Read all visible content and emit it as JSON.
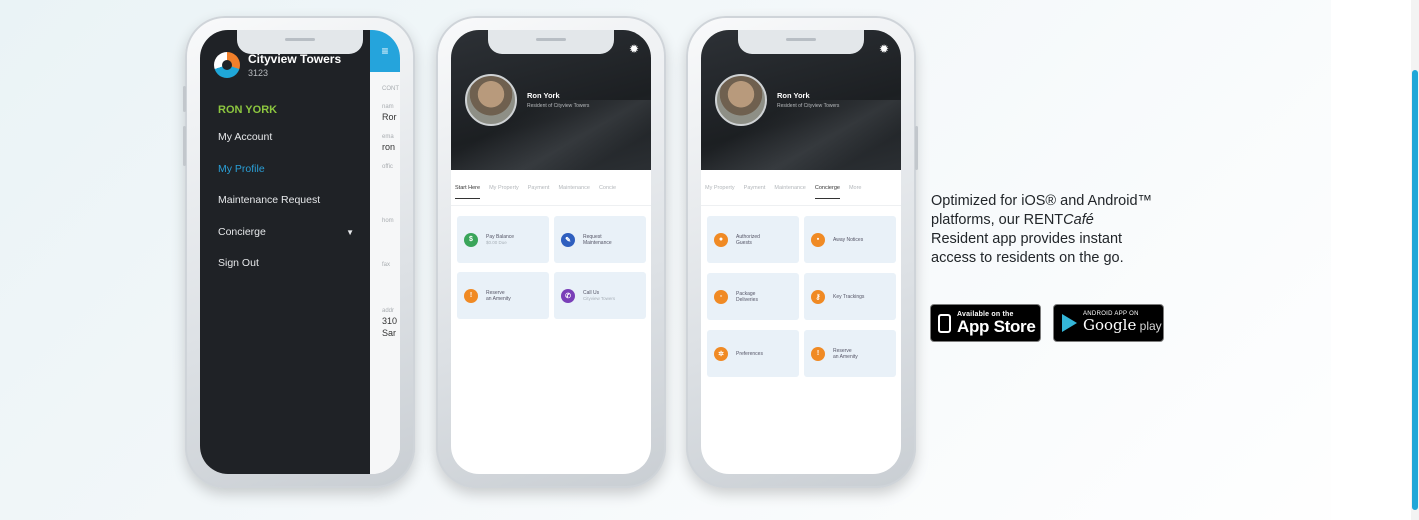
{
  "phone1": {
    "app_name": "Cityview Towers",
    "unit": "3123",
    "user_name": "RON YORK",
    "menu_items": [
      {
        "label": "My Account"
      },
      {
        "label": "My Profile"
      },
      {
        "label": "Maintenance Request"
      },
      {
        "label": "Concierge"
      },
      {
        "label": "Sign Out"
      }
    ],
    "profile_strip": {
      "section": "CONT",
      "fields": [
        {
          "label": "nam",
          "value": "Ror"
        },
        {
          "label": "ema",
          "value": "ron"
        },
        {
          "label": "offic",
          "value": ""
        },
        {
          "label": "hom",
          "value": ""
        },
        {
          "label": "fax",
          "value": ""
        },
        {
          "label": "addr",
          "value": "310"
        },
        {
          "label": "",
          "value": "Sar"
        }
      ]
    }
  },
  "phone2": {
    "name": "Ron York",
    "subtitle": "Resident of Cityview Towers",
    "tabs": [
      "Start Here",
      "My Property",
      "Payment",
      "Maintenance",
      "Concie"
    ],
    "tiles": [
      {
        "line1": "Pay Balance",
        "line2": "$0.00 Due",
        "color": "#3aa55a",
        "icon": "$"
      },
      {
        "line1": "Request",
        "line2": "Maintenance",
        "color": "#2f5fbf",
        "icon": "✎"
      },
      {
        "line1": "Reserve",
        "line2": "an Amenity",
        "color": "#f08a24",
        "icon": "!"
      },
      {
        "line1": "Call Us",
        "line2": "Cityview Towers",
        "color": "#7a3fb8",
        "icon": "✆"
      }
    ]
  },
  "phone3": {
    "name": "Ron York",
    "subtitle": "Resident of Cityview Towers",
    "tabs": [
      "My Property",
      "Payment",
      "Maintenance",
      "Concierge",
      "More"
    ],
    "tiles": [
      {
        "line1": "Authorized",
        "line2": "Guests"
      },
      {
        "line1": "Away Notices",
        "line2": ""
      },
      {
        "line1": "Package",
        "line2": "Deliveries"
      },
      {
        "line1": "Key Trackings",
        "line2": ""
      },
      {
        "line1": "Preferences",
        "line2": ""
      },
      {
        "line1": "Reserve",
        "line2": "an Amenity"
      }
    ],
    "tile_color": "#f08a24"
  },
  "blurb": {
    "line1": "Optimized for iOS® and Android™",
    "line2a": "platforms, our RENT",
    "line2b": "Café",
    "line3": "Resident app provides instant",
    "line4": "access to residents on the go."
  },
  "badges": {
    "apple_small": "Available on the",
    "apple_big": "App Store",
    "google_small": "ANDROID APP ON",
    "google_big_a": "Google",
    "google_big_b": " play"
  },
  "colors": {
    "accent_blue": "#25a4dc",
    "accent_green": "#8cc63f",
    "menu_bg": "#1f2226"
  }
}
